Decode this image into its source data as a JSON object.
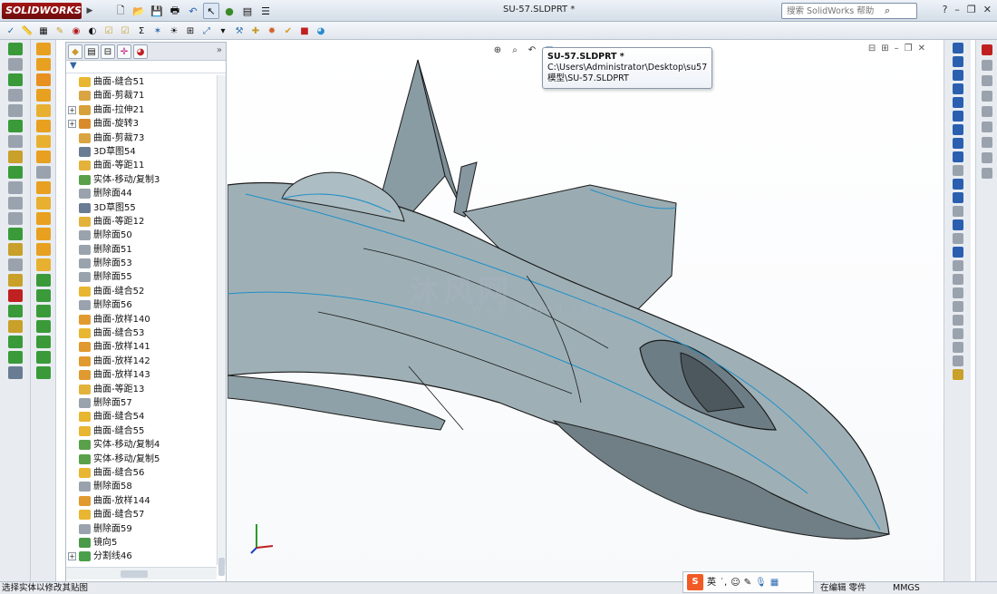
{
  "app": {
    "logo_text": "SOLIDWORKS",
    "document_title": "SU-57.SLDPRT *"
  },
  "search": {
    "placeholder": "搜索 SolidWorks 帮助"
  },
  "tooltip": {
    "title": "SU-57.SLDPRT *",
    "path_line1": "C:\\Users\\Administrator\\Desktop\\su57",
    "path_line2": "模型\\SU-57.SLDPRT"
  },
  "feature_tree": {
    "items": [
      {
        "label": "曲面-缝合51",
        "icon": "knit-surface-icon",
        "color": "#e8b630",
        "expandable": false
      },
      {
        "label": "曲面-剪裁71",
        "icon": "trim-surface-icon",
        "color": "#d9a441",
        "expandable": false
      },
      {
        "label": "曲面-拉伸21",
        "icon": "extrude-surface-icon",
        "color": "#d7a13a",
        "expandable": true
      },
      {
        "label": "曲面-旋转3",
        "icon": "revolve-surface-icon",
        "color": "#d98b2b",
        "expandable": true
      },
      {
        "label": "曲面-剪裁73",
        "icon": "trim-surface-icon",
        "color": "#d9a441",
        "expandable": false
      },
      {
        "label": "3D草图54",
        "icon": "3d-sketch-icon",
        "color": "#6a7c94",
        "expandable": false
      },
      {
        "label": "曲面-等距11",
        "icon": "offset-surface-icon",
        "color": "#e3b23a",
        "expandable": false
      },
      {
        "label": "实体-移动/复制3",
        "icon": "move-copy-icon",
        "color": "#5aa04a",
        "expandable": false
      },
      {
        "label": "删除面44",
        "icon": "delete-face-icon",
        "color": "#9aa3ad",
        "expandable": false
      },
      {
        "label": "3D草图55",
        "icon": "3d-sketch-icon",
        "color": "#6a7c94",
        "expandable": false
      },
      {
        "label": "曲面-等距12",
        "icon": "offset-surface-icon",
        "color": "#e3b23a",
        "expandable": false
      },
      {
        "label": "删除面50",
        "icon": "delete-face-icon",
        "color": "#9aa3ad",
        "expandable": false
      },
      {
        "label": "删除面51",
        "icon": "delete-face-icon",
        "color": "#9aa3ad",
        "expandable": false
      },
      {
        "label": "删除面53",
        "icon": "delete-face-icon",
        "color": "#9aa3ad",
        "expandable": false
      },
      {
        "label": "删除面55",
        "icon": "delete-face-icon",
        "color": "#9aa3ad",
        "expandable": false
      },
      {
        "label": "曲面-缝合52",
        "icon": "knit-surface-icon",
        "color": "#e8b630",
        "expandable": false
      },
      {
        "label": "删除面56",
        "icon": "delete-face-icon",
        "color": "#9aa3ad",
        "expandable": false
      },
      {
        "label": "曲面-放样140",
        "icon": "loft-surface-icon",
        "color": "#e19a2f",
        "expandable": false
      },
      {
        "label": "曲面-缝合53",
        "icon": "knit-surface-icon",
        "color": "#e8b630",
        "expandable": false
      },
      {
        "label": "曲面-放样141",
        "icon": "loft-surface-icon",
        "color": "#e19a2f",
        "expandable": false
      },
      {
        "label": "曲面-放样142",
        "icon": "loft-surface-icon",
        "color": "#e19a2f",
        "expandable": false
      },
      {
        "label": "曲面-放样143",
        "icon": "loft-surface-icon",
        "color": "#e19a2f",
        "expandable": false
      },
      {
        "label": "曲面-等距13",
        "icon": "offset-surface-icon",
        "color": "#e3b23a",
        "expandable": false
      },
      {
        "label": "删除面57",
        "icon": "delete-face-icon",
        "color": "#9aa3ad",
        "expandable": false
      },
      {
        "label": "曲面-缝合54",
        "icon": "knit-surface-icon",
        "color": "#e8b630",
        "expandable": false
      },
      {
        "label": "曲面-缝合55",
        "icon": "knit-surface-icon",
        "color": "#e8b630",
        "expandable": false
      },
      {
        "label": "实体-移动/复制4",
        "icon": "move-copy-icon",
        "color": "#5aa04a",
        "expandable": false
      },
      {
        "label": "实体-移动/复制5",
        "icon": "move-copy-icon",
        "color": "#5aa04a",
        "expandable": false
      },
      {
        "label": "曲面-缝合56",
        "icon": "knit-surface-icon",
        "color": "#e8b630",
        "expandable": false
      },
      {
        "label": "删除面58",
        "icon": "delete-face-icon",
        "color": "#9aa3ad",
        "expandable": false
      },
      {
        "label": "曲面-放样144",
        "icon": "loft-surface-icon",
        "color": "#e19a2f",
        "expandable": false
      },
      {
        "label": "曲面-缝合57",
        "icon": "knit-surface-icon",
        "color": "#e8b630",
        "expandable": false
      },
      {
        "label": "删除面59",
        "icon": "delete-face-icon",
        "color": "#9aa3ad",
        "expandable": false
      },
      {
        "label": "镜向5",
        "icon": "mirror-icon",
        "color": "#4a9a4a",
        "expandable": false
      },
      {
        "label": "分割线46",
        "icon": "split-line-icon",
        "color": "#4aa04a",
        "expandable": true
      }
    ]
  },
  "watermark": {
    "text": "沐风网",
    "sub": "www.mfcad.com"
  },
  "ime": {
    "logo": "S",
    "lang": "英"
  },
  "status": {
    "message": "选择实体以修改其贴图",
    "mode": "在编辑 零件",
    "units": "MMGS"
  },
  "colors": {
    "model_fill": "#9eb0b6",
    "model_edge": "#1f8fc7",
    "model_outline": "#1a1a1a"
  }
}
